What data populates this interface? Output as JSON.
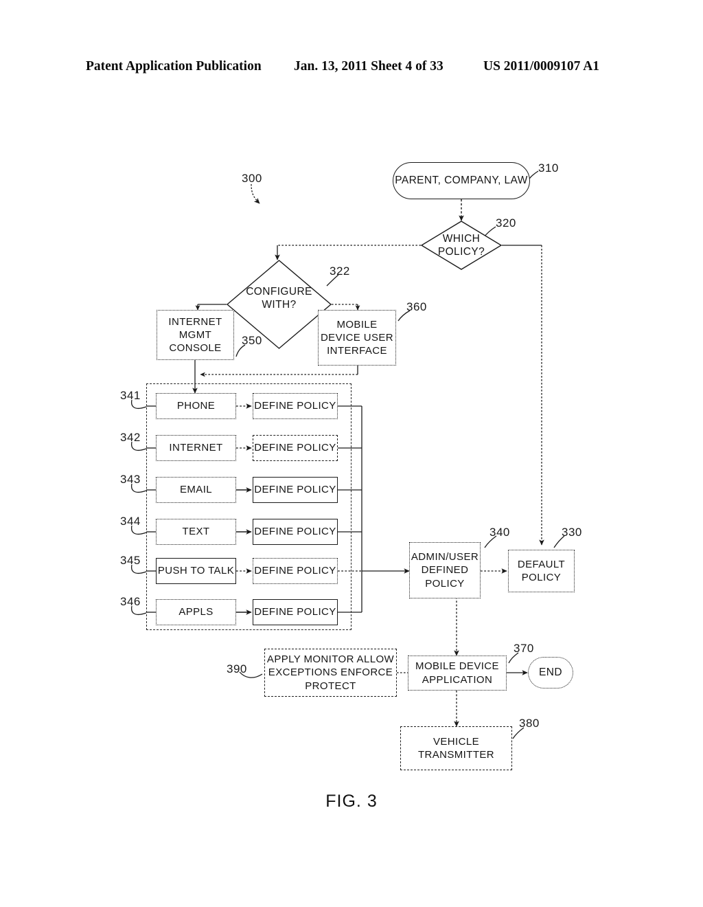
{
  "header": {
    "publication": "Patent Application Publication",
    "date_sheet": "Jan. 13, 2011  Sheet 4 of 33",
    "pub_number": "US 2011/0009107 A1"
  },
  "figure": {
    "caption": "FIG. 3",
    "diagram_ref": "300"
  },
  "nodes": {
    "start": {
      "label": "PARENT, COMPANY, LAW",
      "ref": "310",
      "shape": "terminator"
    },
    "which_policy": {
      "label_line1": "WHICH",
      "label_line2": "POLICY?",
      "ref": "320",
      "shape": "decision"
    },
    "configure_with": {
      "label_line1": "CONFIGURE",
      "label_line2": "WITH?",
      "ref": "322",
      "shape": "decision"
    },
    "internet_mgmt_console": {
      "label": "INTERNET\nMGMT\nCONSOLE",
      "ref": "350",
      "shape": "process"
    },
    "mobile_device_user_interface": {
      "label": "MOBILE\nDEVICE USER\nINTERFACE",
      "ref": "360",
      "shape": "process"
    },
    "admin_user_defined_policy": {
      "label": "ADMIN/USER\nDEFINED\nPOLICY",
      "ref": "340",
      "shape": "process"
    },
    "default_policy": {
      "label": "DEFAULT\nPOLICY",
      "ref": "330",
      "shape": "process"
    },
    "apply_monitor": {
      "label": "APPLY MONITOR ALLOW\nEXCEPTIONS ENFORCE\nPROTECT",
      "ref": "390",
      "shape": "process"
    },
    "mobile_device_application": {
      "label": "MOBILE DEVICE\nAPPLICATION",
      "ref": "370",
      "shape": "process"
    },
    "vehicle_transmitter": {
      "label": "VEHICLE\nTRANSMITTER",
      "ref": "380",
      "shape": "process"
    },
    "end": {
      "label": "END",
      "shape": "terminator"
    }
  },
  "policy_rows": [
    {
      "ref": "341",
      "category": "PHONE",
      "action": "DEFINE POLICY"
    },
    {
      "ref": "342",
      "category": "INTERNET",
      "action": "DEFINE POLICY"
    },
    {
      "ref": "343",
      "category": "EMAIL",
      "action": "DEFINE POLICY"
    },
    {
      "ref": "344",
      "category": "TEXT",
      "action": "DEFINE POLICY"
    },
    {
      "ref": "345",
      "category": "PUSH TO TALK",
      "action": "DEFINE POLICY"
    },
    {
      "ref": "346",
      "category": "APPLS",
      "action": "DEFINE POLICY"
    }
  ],
  "colors": {
    "ink": "#1a1a1a",
    "background": "#ffffff"
  }
}
